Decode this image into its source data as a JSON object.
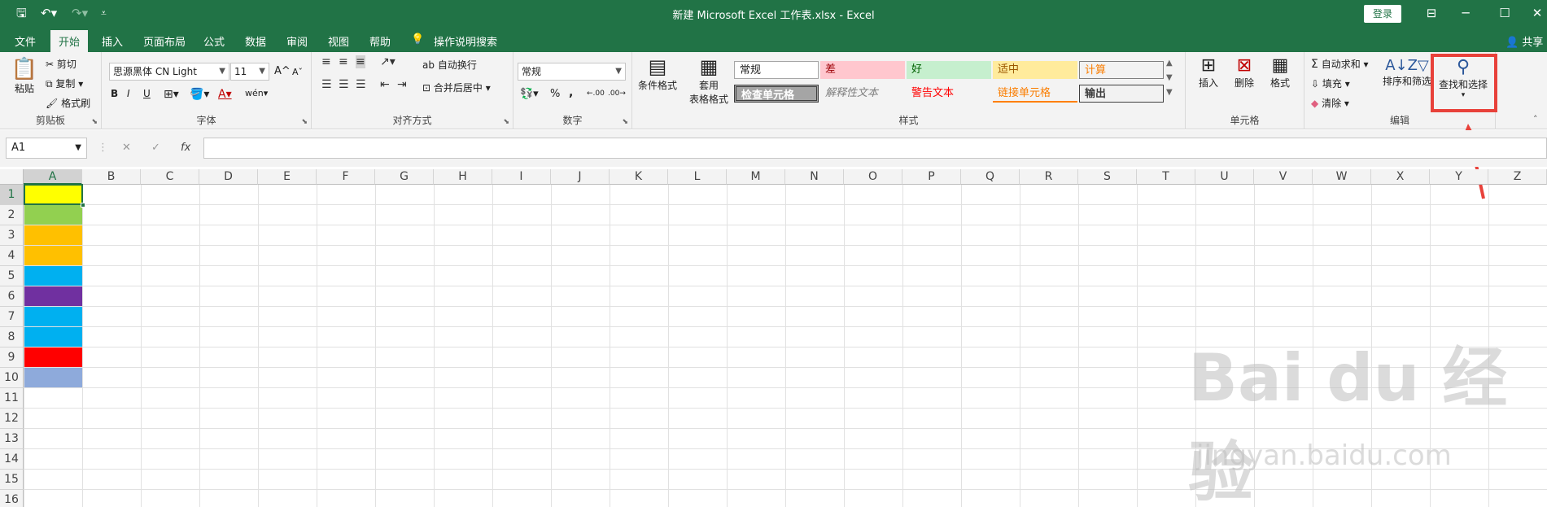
{
  "title": "新建 Microsoft Excel 工作表.xlsx  -  Excel",
  "login": "登录",
  "share": "共享",
  "tabs": [
    "文件",
    "开始",
    "插入",
    "页面布局",
    "公式",
    "数据",
    "审阅",
    "视图",
    "帮助",
    "操作说明搜索"
  ],
  "clipboard": {
    "paste": "粘贴",
    "cut": "剪切",
    "copy": "复制",
    "painter": "格式刷",
    "label": "剪贴板"
  },
  "font": {
    "name": "思源黑体 CN Light",
    "size": "11",
    "label": "字体",
    "bold": "B",
    "italic": "I",
    "underline": "U",
    "grow": "A",
    "shrink": "A",
    "ruby": "wén"
  },
  "align": {
    "wrap": "自动换行",
    "merge": "合并后居中",
    "label": "对齐方式"
  },
  "number": {
    "format": "常规",
    "percent": "%",
    "comma": ",",
    "label": "数字"
  },
  "styles": {
    "cond": "条件格式",
    "table1": "套用",
    "table2": "表格格式",
    "label": "样式",
    "cells": [
      "常规",
      "差",
      "好",
      "适中",
      "计算",
      "检查单元格",
      "解释性文本",
      "警告文本",
      "链接单元格",
      "输出"
    ]
  },
  "cells_grp": {
    "insert": "插入",
    "delete": "删除",
    "format": "格式",
    "label": "单元格"
  },
  "editing": {
    "autosum": "自动求和",
    "fill": "填充",
    "clear": "清除",
    "sort": "排序和筛选",
    "find": "查找和选择",
    "label": "编辑"
  },
  "namebox": "A1",
  "formula_icons": {
    "cancel": "✕",
    "enter": "✓",
    "fx": "fx"
  },
  "columns": [
    "A",
    "B",
    "C",
    "D",
    "E",
    "F",
    "G",
    "H",
    "I",
    "J",
    "K",
    "L",
    "M",
    "N",
    "O",
    "P",
    "Q",
    "R",
    "S",
    "T",
    "U",
    "V",
    "W",
    "X",
    "Y",
    "Z"
  ],
  "rows": [
    "1",
    "2",
    "3",
    "4",
    "5",
    "6",
    "7",
    "8",
    "9",
    "10",
    "11",
    "12",
    "13",
    "14",
    "15",
    "16"
  ],
  "cell_colors": [
    "#ffff00",
    "#92d050",
    "#ffc000",
    "#ffc000",
    "#00b0f0",
    "#7030a0",
    "#00b0f0",
    "#00b0f0",
    "#ff0000",
    "#8eaadb"
  ],
  "watermark": "Bai du 经验",
  "watermark_url": "jingyan.baidu.com"
}
